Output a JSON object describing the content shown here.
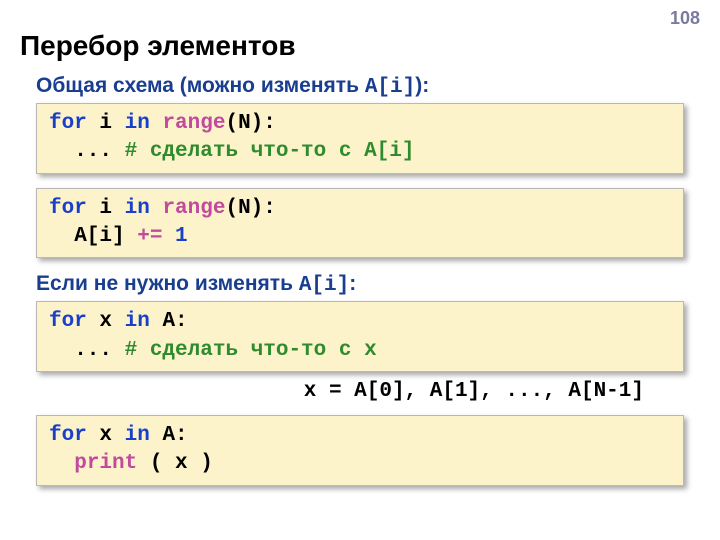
{
  "page_number": "108",
  "title": "Перебор элементов",
  "subhead1_prefix": "Общая схема (можно изменять ",
  "subhead1_code": "A[i]",
  "subhead1_suffix": "):",
  "code1": {
    "l1_kw1": "for",
    "l1_txt1": " i ",
    "l1_kw2": "in",
    "l1_txt2": " ",
    "l1_fn": "range",
    "l1_txt3": "(N):",
    "l2_txt1": "  ... ",
    "l2_cmt": "# сделать что-то с A[i]"
  },
  "code2": {
    "l1_kw1": "for",
    "l1_txt1": " i ",
    "l1_kw2": "in",
    "l1_txt2": " ",
    "l1_fn": "range",
    "l1_txt3": "(N):",
    "l2_txt1": "  A[i]",
    "l2_op": " += ",
    "l2_num": "1"
  },
  "subhead2_prefix": "Если не нужно изменять ",
  "subhead2_code": "A[i]",
  "subhead2_suffix": ":",
  "code3": {
    "l1_kw1": "for",
    "l1_txt1": " x ",
    "l1_kw2": "in",
    "l1_txt2": " A:",
    "l2_txt1": "  ... ",
    "l2_cmt": "# сделать что-то с x"
  },
  "annot": "x = A[0], A[1], ..., A[N-1]",
  "code4": {
    "l1_kw1": "for",
    "l1_txt1": " x ",
    "l1_kw2": "in",
    "l1_txt2": " A:",
    "l2_txt1": "  ",
    "l2_fn": "print",
    "l2_txt2": " ( x )"
  }
}
